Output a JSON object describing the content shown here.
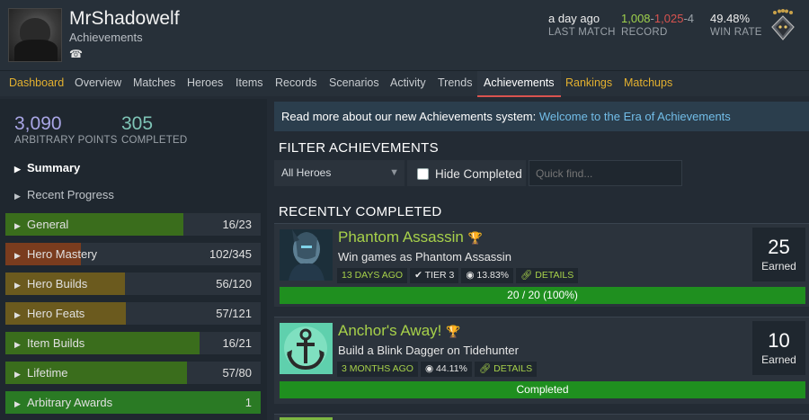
{
  "profile": {
    "username": "MrShadowelf",
    "subtitle": "Achievements",
    "phone_icon": "phone-icon"
  },
  "header_stats": {
    "last_match": {
      "value": "a day ago",
      "label": "LAST MATCH"
    },
    "record": {
      "wins": "1,008",
      "sep1": "-",
      "losses": "1,025",
      "sep2": "-",
      "abandons": "4",
      "label": "RECORD"
    },
    "win_rate": {
      "value": "49.48%",
      "label": "WIN RATE"
    },
    "rank_icon": "rank-medal-icon"
  },
  "nav": {
    "items": [
      {
        "label": "Dashboard"
      },
      {
        "label": "Overview"
      },
      {
        "label": "Matches"
      },
      {
        "label": "Heroes"
      },
      {
        "label": "Items"
      },
      {
        "label": "Records"
      },
      {
        "label": "Scenarios"
      },
      {
        "label": "Activity"
      },
      {
        "label": "Trends"
      },
      {
        "label": "Achievements"
      },
      {
        "label": "Rankings"
      },
      {
        "label": "Matchups"
      }
    ],
    "active": "Achievements"
  },
  "summary": {
    "points": {
      "value": "3,090",
      "label": "ARBITRARY POINTS"
    },
    "completed": {
      "value": "305",
      "label": "COMPLETED"
    },
    "links": [
      {
        "label": "Summary"
      },
      {
        "label": "Recent Progress"
      }
    ],
    "categories": [
      {
        "label": "General",
        "count": "16/23",
        "progress": 0.6957,
        "color": "#3a6d1c"
      },
      {
        "label": "Hero Mastery",
        "count": "102/345",
        "progress": 0.2957,
        "color": "#7a3c1e"
      },
      {
        "label": "Hero Builds",
        "count": "56/120",
        "progress": 0.4667,
        "color": "#6b5a1e"
      },
      {
        "label": "Hero Feats",
        "count": "57/121",
        "progress": 0.4711,
        "color": "#6b5a1e"
      },
      {
        "label": "Item Builds",
        "count": "16/21",
        "progress": 0.7619,
        "color": "#3a6d1c"
      },
      {
        "label": "Lifetime",
        "count": "57/80",
        "progress": 0.7125,
        "color": "#3a6d1c"
      },
      {
        "label": "Arbitrary Awards",
        "count": "1",
        "progress": 1.0,
        "color": "#2a7a24"
      }
    ]
  },
  "info_bar": {
    "text": "Read more about our new Achievements system: ",
    "link": "Welcome to the Era of Achievements"
  },
  "filter": {
    "title": "FILTER ACHIEVEMENTS",
    "hero_select": "All Heroes",
    "hide_completed_label": "Hide Completed",
    "quick_find_placeholder": "Quick find..."
  },
  "recent": {
    "title": "RECENTLY COMPLETED",
    "cards": [
      {
        "title": "Phantom Assassin",
        "description": "Win games as Phantom Assassin",
        "tags": {
          "date": "13 DAYS AGO",
          "tier": "TIER 3",
          "pct": "13.83%",
          "details": "DETAILS"
        },
        "progress_text": "20 / 20 (100%)",
        "earned": "25",
        "earned_label": "Earned"
      },
      {
        "title": "Anchor's Away!",
        "description": "Build a Blink Dagger on Tidehunter",
        "tags": {
          "date": "3 MONTHS AGO",
          "pct": "44.11%",
          "details": "DETAILS"
        },
        "progress_text": "Completed",
        "earned": "10",
        "earned_label": "Earned"
      }
    ]
  }
}
